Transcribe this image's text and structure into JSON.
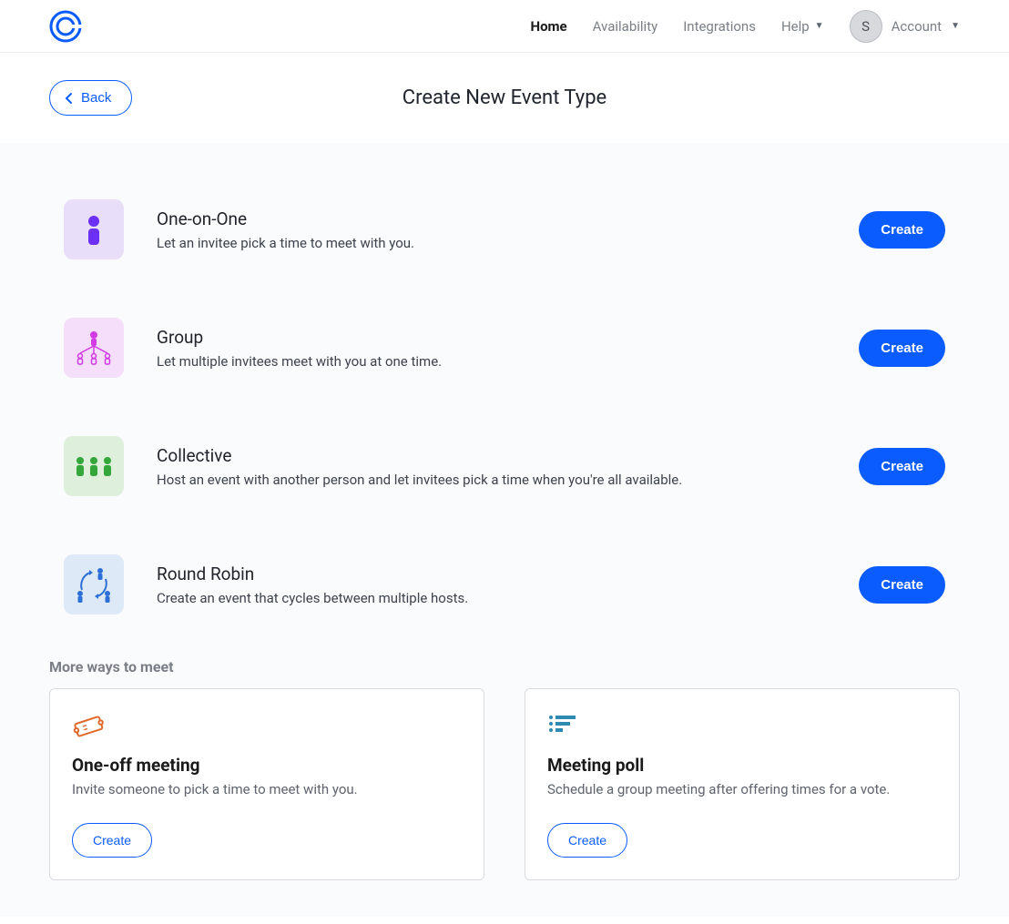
{
  "header": {
    "nav": {
      "home": "Home",
      "availability": "Availability",
      "integrations": "Integrations",
      "help": "Help",
      "account": "Account"
    },
    "avatar_initial": "S"
  },
  "title_bar": {
    "back": "Back",
    "page_title": "Create New Event Type"
  },
  "events": [
    {
      "title": "One-on-One",
      "desc": "Let an invitee pick a time to meet with you.",
      "button": "Create"
    },
    {
      "title": "Group",
      "desc": "Let multiple invitees meet with you at one time.",
      "button": "Create"
    },
    {
      "title": "Collective",
      "desc": "Host an event with another person and let invitees pick a time when you're all available.",
      "button": "Create"
    },
    {
      "title": "Round Robin",
      "desc": "Create an event that cycles between multiple hosts.",
      "button": "Create"
    }
  ],
  "more_section": {
    "heading": "More ways to meet",
    "cards": [
      {
        "title": "One-off meeting",
        "desc": "Invite someone to pick a time to meet with you.",
        "button": "Create"
      },
      {
        "title": "Meeting poll",
        "desc": "Schedule a group meeting after offering times for a vote.",
        "button": "Create"
      }
    ]
  }
}
